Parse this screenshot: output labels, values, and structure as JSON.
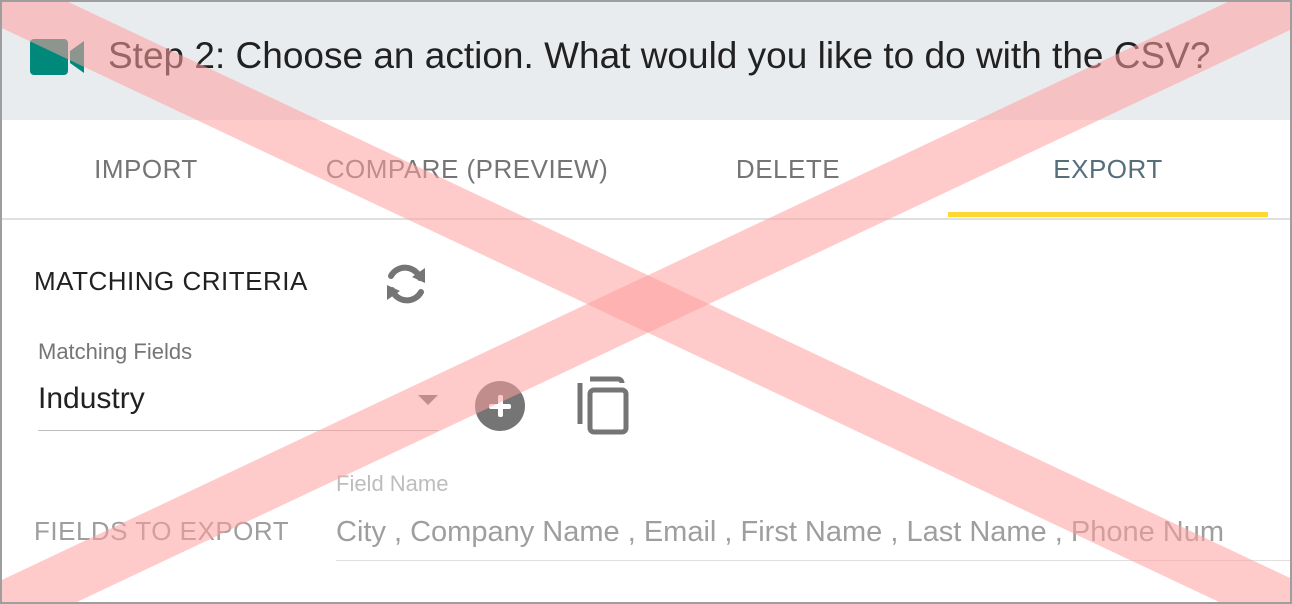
{
  "header": {
    "title": "Step 2: Choose an action. What would you like to do with the CSV?",
    "icon": "video-camera-icon",
    "icon_color": "#00897b"
  },
  "tabs": [
    {
      "label": "IMPORT",
      "active": false
    },
    {
      "label": "COMPARE (PREVIEW)",
      "active": false
    },
    {
      "label": "DELETE",
      "active": false
    },
    {
      "label": "EXPORT",
      "active": true
    }
  ],
  "accent_color": "#fdd835",
  "matching": {
    "title": "MATCHING CRITERIA",
    "refresh_icon": "refresh-icon",
    "field_label": "Matching Fields",
    "selected_value": "Industry",
    "add_icon": "add-circle-icon",
    "copy_icon": "copy-icon"
  },
  "export": {
    "title": "FIELDS TO EXPORT",
    "field_name_label": "Field Name",
    "fields_value": "City , Company Name , Email , First Name , Last Name , Phone Num"
  },
  "overlay": {
    "type": "disabled-x-mark",
    "color": "#ffcdd2"
  }
}
